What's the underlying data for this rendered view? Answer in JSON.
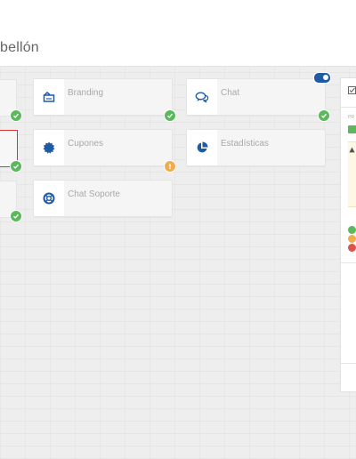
{
  "header": {
    "page_title": "bellón"
  },
  "cards": [
    {
      "label": "Branding",
      "icon": "branding-icon",
      "status": "ok"
    },
    {
      "label": "Chat",
      "icon": "chat-icon",
      "status": "ok"
    },
    {
      "label": "Cupones",
      "icon": "coupon-icon",
      "status": "warn"
    },
    {
      "label": "Estadísticas",
      "icon": "stats-icon",
      "status": "none"
    },
    {
      "label": "Chat Soporte",
      "icon": "support-icon",
      "status": "none"
    }
  ],
  "right_panel": {
    "truncated_label": "PR"
  },
  "colors": {
    "accent": "#1f5aa6",
    "ok": "#5cb85c",
    "warn": "#f0ad4e",
    "danger": "#d9534f",
    "selected_border": "#d9312b"
  }
}
